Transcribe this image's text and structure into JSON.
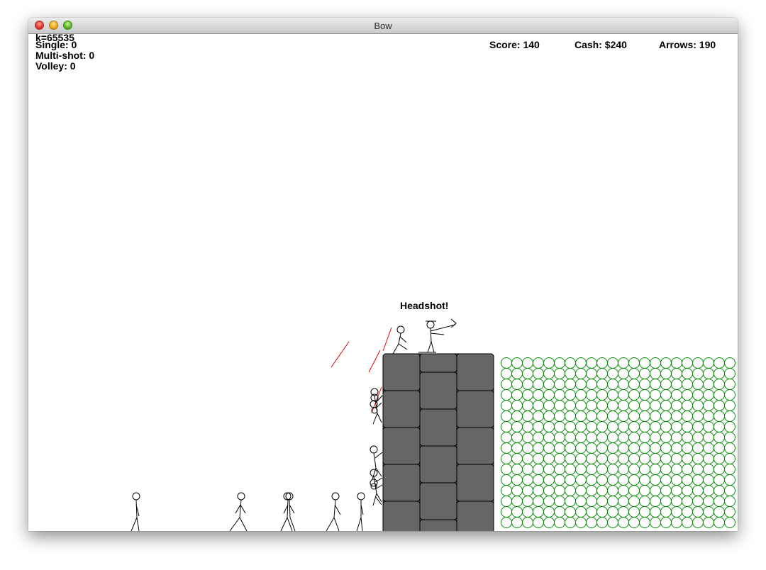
{
  "window": {
    "title": "Bow"
  },
  "hud": {
    "debug": "k=65535",
    "single": "Single: 0",
    "multi_shot": "Multi-shot: 0",
    "volley": "Volley: 0",
    "score": "Score: 140",
    "cash": "Cash: $240",
    "arrows": "Arrows: 190"
  },
  "message": "Headshot!",
  "colors": {
    "tower": "#666666",
    "tower_mortar": "#000000",
    "ammo_circles": "#0a8a0a",
    "arrow": "#e00000",
    "stick_figure": "#000000"
  }
}
